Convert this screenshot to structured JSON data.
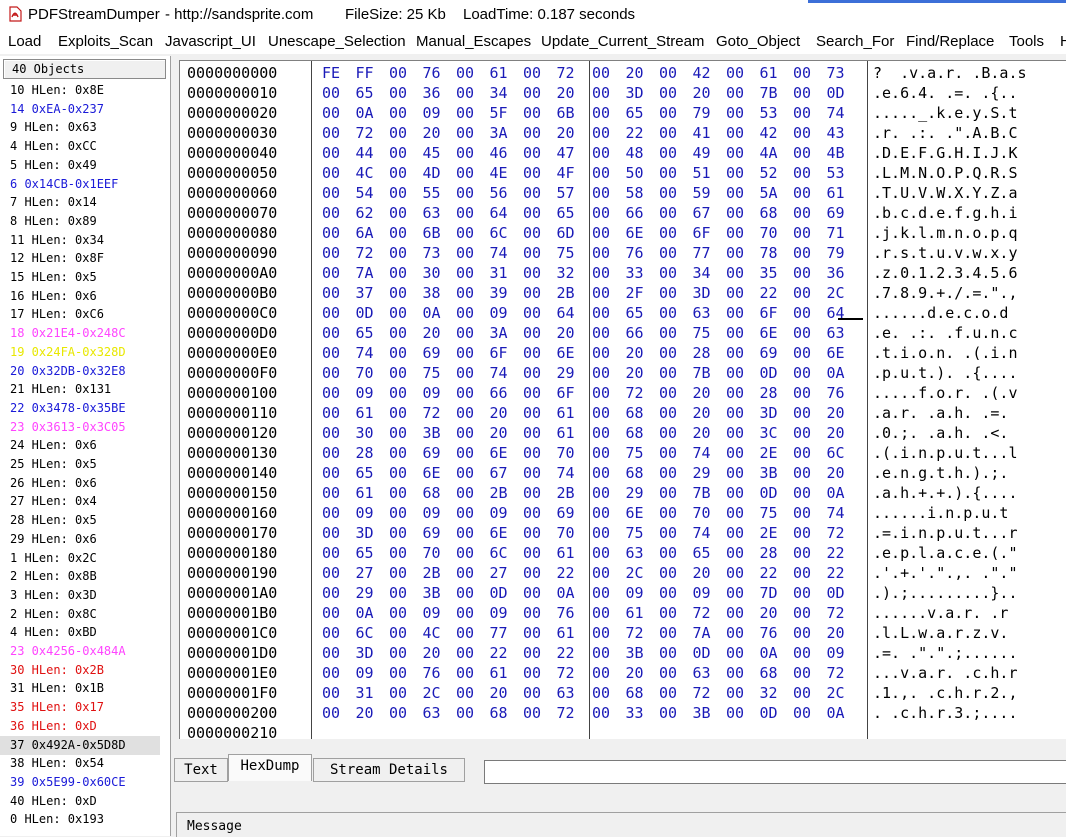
{
  "window": {
    "title": "PDFStreamDumper",
    "url": "- http://sandsprite.com",
    "filesize": "FileSize: 25 Kb",
    "loadtime": "LoadTime: 0.187 seconds",
    "icon": "pdf-app-icon"
  },
  "menu": [
    "Load",
    "Exploits_Scan",
    "Javascript_UI",
    "Unescape_Selection",
    "Manual_Escapes",
    "Update_Current_Stream",
    "Goto_Object",
    "Search_For",
    "Find/Replace",
    "Tools",
    "H"
  ],
  "objects": {
    "header": "40 Objects",
    "items": [
      {
        "label": "10 HLen: 0x8E",
        "color": "#000000"
      },
      {
        "label": "14 0xEA-0x237",
        "color": "#1a1ad8"
      },
      {
        "label": "9 HLen: 0x63",
        "color": "#000000"
      },
      {
        "label": "4 HLen: 0xCC",
        "color": "#000000"
      },
      {
        "label": "5 HLen: 0x49",
        "color": "#000000"
      },
      {
        "label": "6 0x14CB-0x1EEF",
        "color": "#1a1ad8"
      },
      {
        "label": "7 HLen: 0x14",
        "color": "#000000"
      },
      {
        "label": "8 HLen: 0x89",
        "color": "#000000"
      },
      {
        "label": "11 HLen: 0x34",
        "color": "#000000"
      },
      {
        "label": "12 HLen: 0x8F",
        "color": "#000000"
      },
      {
        "label": "15 HLen: 0x5",
        "color": "#000000"
      },
      {
        "label": "16 HLen: 0x6",
        "color": "#000000"
      },
      {
        "label": "17 HLen: 0xC6",
        "color": "#000000"
      },
      {
        "label": "18 0x21E4-0x248C",
        "color": "#ff44ff"
      },
      {
        "label": "19 0x24FA-0x328D",
        "color": "#e8e800"
      },
      {
        "label": "20 0x32DB-0x32E8",
        "color": "#1a1ad8"
      },
      {
        "label": "21 HLen: 0x131",
        "color": "#000000"
      },
      {
        "label": "22 0x3478-0x35BE",
        "color": "#1a1ad8"
      },
      {
        "label": "23 0x3613-0x3C05",
        "color": "#ff44ff"
      },
      {
        "label": "24 HLen: 0x6",
        "color": "#000000"
      },
      {
        "label": "25 HLen: 0x5",
        "color": "#000000"
      },
      {
        "label": "26 HLen: 0x6",
        "color": "#000000"
      },
      {
        "label": "27 HLen: 0x4",
        "color": "#000000"
      },
      {
        "label": "28 HLen: 0x5",
        "color": "#000000"
      },
      {
        "label": "29 HLen: 0x6",
        "color": "#000000"
      },
      {
        "label": "1 HLen: 0x2C",
        "color": "#000000"
      },
      {
        "label": "2 HLen: 0x8B",
        "color": "#000000"
      },
      {
        "label": "3 HLen: 0x3D",
        "color": "#000000"
      },
      {
        "label": "2 HLen: 0x8C",
        "color": "#000000"
      },
      {
        "label": "4 HLen: 0xBD",
        "color": "#000000"
      },
      {
        "label": "23 0x4256-0x484A",
        "color": "#ff44ff"
      },
      {
        "label": "30 HLen: 0x2B",
        "color": "#e01010"
      },
      {
        "label": "31 HLen: 0x1B",
        "color": "#000000"
      },
      {
        "label": "35 HLen: 0x17",
        "color": "#e01010"
      },
      {
        "label": "36 HLen: 0xD",
        "color": "#e01010"
      },
      {
        "label": "37 0x492A-0x5D8D",
        "color": "#000000",
        "selected": true
      },
      {
        "label": "38 HLen: 0x54",
        "color": "#000000"
      },
      {
        "label": "39 0x5E99-0x60CE",
        "color": "#1a1ad8"
      },
      {
        "label": "40 HLen: 0xD",
        "color": "#000000"
      },
      {
        "label": "0 HLen: 0x193",
        "color": "#000000"
      }
    ]
  },
  "hexdump": {
    "rows": [
      {
        "offset": "0000000000",
        "bytes": [
          "FE",
          "FF",
          "00",
          "76",
          "00",
          "61",
          "00",
          "72",
          "00",
          "20",
          "00",
          "42",
          "00",
          "61",
          "00",
          "73"
        ],
        "ascii": "?  .v.a.r. .B.a.s"
      },
      {
        "offset": "0000000010",
        "bytes": [
          "00",
          "65",
          "00",
          "36",
          "00",
          "34",
          "00",
          "20",
          "00",
          "3D",
          "00",
          "20",
          "00",
          "7B",
          "00",
          "0D"
        ],
        "ascii": ".e.6.4. .=. .{.."
      },
      {
        "offset": "0000000020",
        "bytes": [
          "00",
          "0A",
          "00",
          "09",
          "00",
          "5F",
          "00",
          "6B",
          "00",
          "65",
          "00",
          "79",
          "00",
          "53",
          "00",
          "74"
        ],
        "ascii": "....._.k.e.y.S.t"
      },
      {
        "offset": "0000000030",
        "bytes": [
          "00",
          "72",
          "00",
          "20",
          "00",
          "3A",
          "00",
          "20",
          "00",
          "22",
          "00",
          "41",
          "00",
          "42",
          "00",
          "43"
        ],
        "ascii": ".r. .:. .\".A.B.C"
      },
      {
        "offset": "0000000040",
        "bytes": [
          "00",
          "44",
          "00",
          "45",
          "00",
          "46",
          "00",
          "47",
          "00",
          "48",
          "00",
          "49",
          "00",
          "4A",
          "00",
          "4B"
        ],
        "ascii": ".D.E.F.G.H.I.J.K"
      },
      {
        "offset": "0000000050",
        "bytes": [
          "00",
          "4C",
          "00",
          "4D",
          "00",
          "4E",
          "00",
          "4F",
          "00",
          "50",
          "00",
          "51",
          "00",
          "52",
          "00",
          "53"
        ],
        "ascii": ".L.M.N.O.P.Q.R.S"
      },
      {
        "offset": "0000000060",
        "bytes": [
          "00",
          "54",
          "00",
          "55",
          "00",
          "56",
          "00",
          "57",
          "00",
          "58",
          "00",
          "59",
          "00",
          "5A",
          "00",
          "61"
        ],
        "ascii": ".T.U.V.W.X.Y.Z.a"
      },
      {
        "offset": "0000000070",
        "bytes": [
          "00",
          "62",
          "00",
          "63",
          "00",
          "64",
          "00",
          "65",
          "00",
          "66",
          "00",
          "67",
          "00",
          "68",
          "00",
          "69"
        ],
        "ascii": ".b.c.d.e.f.g.h.i"
      },
      {
        "offset": "0000000080",
        "bytes": [
          "00",
          "6A",
          "00",
          "6B",
          "00",
          "6C",
          "00",
          "6D",
          "00",
          "6E",
          "00",
          "6F",
          "00",
          "70",
          "00",
          "71"
        ],
        "ascii": ".j.k.l.m.n.o.p.q"
      },
      {
        "offset": "0000000090",
        "bytes": [
          "00",
          "72",
          "00",
          "73",
          "00",
          "74",
          "00",
          "75",
          "00",
          "76",
          "00",
          "77",
          "00",
          "78",
          "00",
          "79"
        ],
        "ascii": ".r.s.t.u.v.w.x.y"
      },
      {
        "offset": "00000000A0",
        "bytes": [
          "00",
          "7A",
          "00",
          "30",
          "00",
          "31",
          "00",
          "32",
          "00",
          "33",
          "00",
          "34",
          "00",
          "35",
          "00",
          "36"
        ],
        "ascii": ".z.0.1.2.3.4.5.6"
      },
      {
        "offset": "00000000B0",
        "bytes": [
          "00",
          "37",
          "00",
          "38",
          "00",
          "39",
          "00",
          "2B",
          "00",
          "2F",
          "00",
          "3D",
          "00",
          "22",
          "00",
          "2C"
        ],
        "ascii": ".7.8.9.+./.=.\".,"
      },
      {
        "offset": "00000000C0",
        "bytes": [
          "00",
          "0D",
          "00",
          "0A",
          "00",
          "09",
          "00",
          "64",
          "00",
          "65",
          "00",
          "63",
          "00",
          "6F",
          "00",
          "64"
        ],
        "ascii": "......d.e.c.o.d"
      },
      {
        "offset": "00000000D0",
        "bytes": [
          "00",
          "65",
          "00",
          "20",
          "00",
          "3A",
          "00",
          "20",
          "00",
          "66",
          "00",
          "75",
          "00",
          "6E",
          "00",
          "63"
        ],
        "ascii": ".e. .:. .f.u.n.c"
      },
      {
        "offset": "00000000E0",
        "bytes": [
          "00",
          "74",
          "00",
          "69",
          "00",
          "6F",
          "00",
          "6E",
          "00",
          "20",
          "00",
          "28",
          "00",
          "69",
          "00",
          "6E"
        ],
        "ascii": ".t.i.o.n. .(.i.n"
      },
      {
        "offset": "00000000F0",
        "bytes": [
          "00",
          "70",
          "00",
          "75",
          "00",
          "74",
          "00",
          "29",
          "00",
          "20",
          "00",
          "7B",
          "00",
          "0D",
          "00",
          "0A"
        ],
        "ascii": ".p.u.t.). .{...."
      },
      {
        "offset": "0000000100",
        "bytes": [
          "00",
          "09",
          "00",
          "09",
          "00",
          "66",
          "00",
          "6F",
          "00",
          "72",
          "00",
          "20",
          "00",
          "28",
          "00",
          "76"
        ],
        "ascii": ".....f.o.r. .(.v"
      },
      {
        "offset": "0000000110",
        "bytes": [
          "00",
          "61",
          "00",
          "72",
          "00",
          "20",
          "00",
          "61",
          "00",
          "68",
          "00",
          "20",
          "00",
          "3D",
          "00",
          "20"
        ],
        "ascii": ".a.r. .a.h. .=. "
      },
      {
        "offset": "0000000120",
        "bytes": [
          "00",
          "30",
          "00",
          "3B",
          "00",
          "20",
          "00",
          "61",
          "00",
          "68",
          "00",
          "20",
          "00",
          "3C",
          "00",
          "20"
        ],
        "ascii": ".0.;. .a.h. .<. "
      },
      {
        "offset": "0000000130",
        "bytes": [
          "00",
          "28",
          "00",
          "69",
          "00",
          "6E",
          "00",
          "70",
          "00",
          "75",
          "00",
          "74",
          "00",
          "2E",
          "00",
          "6C"
        ],
        "ascii": ".(.i.n.p.u.t...l"
      },
      {
        "offset": "0000000140",
        "bytes": [
          "00",
          "65",
          "00",
          "6E",
          "00",
          "67",
          "00",
          "74",
          "00",
          "68",
          "00",
          "29",
          "00",
          "3B",
          "00",
          "20"
        ],
        "ascii": ".e.n.g.t.h.).;. "
      },
      {
        "offset": "0000000150",
        "bytes": [
          "00",
          "61",
          "00",
          "68",
          "00",
          "2B",
          "00",
          "2B",
          "00",
          "29",
          "00",
          "7B",
          "00",
          "0D",
          "00",
          "0A"
        ],
        "ascii": ".a.h.+.+.).{...."
      },
      {
        "offset": "0000000160",
        "bytes": [
          "00",
          "09",
          "00",
          "09",
          "00",
          "09",
          "00",
          "69",
          "00",
          "6E",
          "00",
          "70",
          "00",
          "75",
          "00",
          "74"
        ],
        "ascii": "......i.n.p.u.t"
      },
      {
        "offset": "0000000170",
        "bytes": [
          "00",
          "3D",
          "00",
          "69",
          "00",
          "6E",
          "00",
          "70",
          "00",
          "75",
          "00",
          "74",
          "00",
          "2E",
          "00",
          "72"
        ],
        "ascii": ".=.i.n.p.u.t...r"
      },
      {
        "offset": "0000000180",
        "bytes": [
          "00",
          "65",
          "00",
          "70",
          "00",
          "6C",
          "00",
          "61",
          "00",
          "63",
          "00",
          "65",
          "00",
          "28",
          "00",
          "22"
        ],
        "ascii": ".e.p.l.a.c.e.(.\""
      },
      {
        "offset": "0000000190",
        "bytes": [
          "00",
          "27",
          "00",
          "2B",
          "00",
          "27",
          "00",
          "22",
          "00",
          "2C",
          "00",
          "20",
          "00",
          "22",
          "00",
          "22"
        ],
        "ascii": ".'.+.'.\".,. .\".\""
      },
      {
        "offset": "00000001A0",
        "bytes": [
          "00",
          "29",
          "00",
          "3B",
          "00",
          "0D",
          "00",
          "0A",
          "00",
          "09",
          "00",
          "09",
          "00",
          "7D",
          "00",
          "0D"
        ],
        "ascii": ".).;.........}.."
      },
      {
        "offset": "00000001B0",
        "bytes": [
          "00",
          "0A",
          "00",
          "09",
          "00",
          "09",
          "00",
          "76",
          "00",
          "61",
          "00",
          "72",
          "00",
          "20",
          "00",
          "72"
        ],
        "ascii": "......v.a.r. .r"
      },
      {
        "offset": "00000001C0",
        "bytes": [
          "00",
          "6C",
          "00",
          "4C",
          "00",
          "77",
          "00",
          "61",
          "00",
          "72",
          "00",
          "7A",
          "00",
          "76",
          "00",
          "20"
        ],
        "ascii": ".l.L.w.a.r.z.v. "
      },
      {
        "offset": "00000001D0",
        "bytes": [
          "00",
          "3D",
          "00",
          "20",
          "00",
          "22",
          "00",
          "22",
          "00",
          "3B",
          "00",
          "0D",
          "00",
          "0A",
          "00",
          "09"
        ],
        "ascii": ".=. .\".\".;......"
      },
      {
        "offset": "00000001E0",
        "bytes": [
          "00",
          "09",
          "00",
          "76",
          "00",
          "61",
          "00",
          "72",
          "00",
          "20",
          "00",
          "63",
          "00",
          "68",
          "00",
          "72"
        ],
        "ascii": "...v.a.r. .c.h.r"
      },
      {
        "offset": "00000001F0",
        "bytes": [
          "00",
          "31",
          "00",
          "2C",
          "00",
          "20",
          "00",
          "63",
          "00",
          "68",
          "00",
          "72",
          "00",
          "32",
          "00",
          "2C"
        ],
        "ascii": ".1.,. .c.h.r.2.,"
      },
      {
        "offset": "0000000200",
        "bytes": [
          "00",
          "20",
          "00",
          "63",
          "00",
          "68",
          "00",
          "72",
          "00",
          "33",
          "00",
          "3B",
          "00",
          "0D",
          "00",
          "0A"
        ],
        "ascii": ". .c.h.r.3.;...."
      },
      {
        "offset": "0000000210",
        "bytes": [],
        "ascii": ""
      }
    ]
  },
  "tabs": [
    {
      "label": "Text",
      "active": false
    },
    {
      "label": "HexDump",
      "active": true
    },
    {
      "label": "Stream Details",
      "active": false
    }
  ],
  "message": {
    "label": "Message"
  },
  "scroll": {
    "left_arrow": "◂",
    "right_arrow": "▸",
    "thumb_grip": "|||"
  }
}
